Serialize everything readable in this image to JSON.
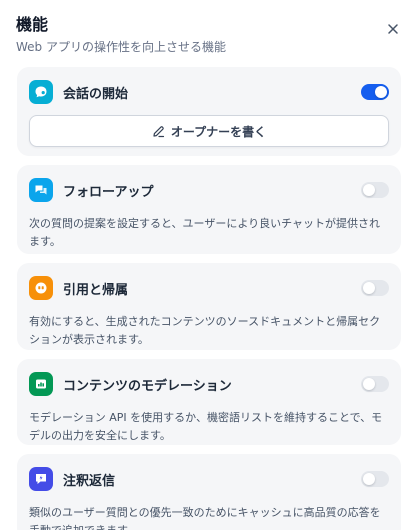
{
  "header": {
    "title": "機能",
    "subtitle": "Web アプリの操作性を向上させる機能"
  },
  "features": [
    {
      "title": "会話の開始",
      "enabled": true,
      "icon": "chat-bubble-icon",
      "icon_color": "#06aed4",
      "button_label": "オープナーを書く"
    },
    {
      "title": "フォローアップ",
      "enabled": false,
      "icon": "follow-up-chat-icon",
      "icon_color": "#0ba5ec",
      "description": "次の質問の提案を設定すると、ユーザーにより良いチャットが提供されます。"
    },
    {
      "title": "引用と帰属",
      "enabled": false,
      "icon": "quote-icon",
      "icon_color": "#f79009",
      "description": "有効にすると、生成されたコンテンツのソースドキュメントと帰属セクションが表示されます。"
    },
    {
      "title": "コンテンツのモデレーション",
      "enabled": false,
      "icon": "moderation-icon",
      "icon_color": "#039855",
      "description": "モデレーション API を使用するか、機密語リストを維持することで、モデルの出力を安全にします。"
    },
    {
      "title": "注釈返信",
      "enabled": false,
      "icon": "annotation-reply-icon",
      "icon_color": "#444ce7",
      "description": "類似のユーザー質問との優先一致のためにキャッシュに高品質の応答を手動で追加できます。"
    }
  ],
  "colors": {
    "accent": "#155eef",
    "card_bg": "#f5f6f8"
  }
}
